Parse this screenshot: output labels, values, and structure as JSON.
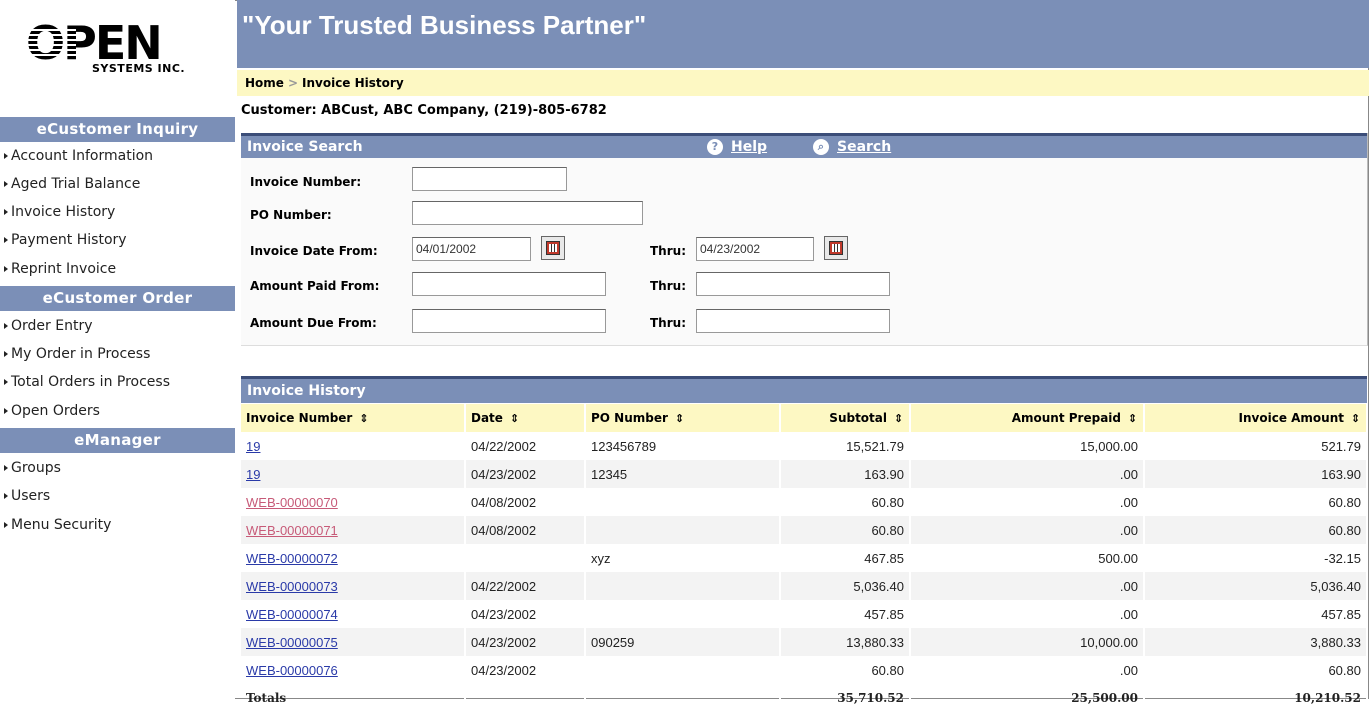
{
  "brand": {
    "logo_word": "OPEN",
    "logo_sub": "SYSTEMS INC."
  },
  "header": {
    "slogan": "\"Your Trusted Business Partner\""
  },
  "breadcrumb": {
    "home": "Home",
    "sep": ">",
    "current": "Invoice History"
  },
  "customer": "Customer: ABCust, ABC Company, (219)-805-6782",
  "sidebar": {
    "sections": [
      {
        "title": "eCustomer Inquiry",
        "items": [
          "Account Information",
          "Aged Trial Balance",
          "Invoice History",
          "Payment History",
          "Reprint Invoice"
        ]
      },
      {
        "title": "eCustomer Order",
        "items": [
          "Order Entry",
          "My Order in Process",
          "Total Orders in Process",
          "Open Orders"
        ]
      },
      {
        "title": "eManager",
        "items": [
          "Groups",
          "Users",
          "Menu Security"
        ]
      }
    ]
  },
  "search": {
    "title": "Invoice Search",
    "help_label": "Help",
    "search_label": "Search",
    "invoice_number_label": "Invoice Number:",
    "invoice_number_value": "",
    "po_number_label": "PO Number:",
    "po_number_value": "",
    "date_from_label": "Invoice Date From:",
    "date_from_value": "04/01/2002",
    "date_thru_label": "Thru:",
    "date_thru_value": "04/23/2002",
    "paid_from_label": "Amount Paid From:",
    "paid_from_value": "",
    "paid_thru_label": "Thru:",
    "paid_thru_value": "",
    "due_from_label": "Amount Due From:",
    "due_from_value": "",
    "due_thru_label": "Thru:",
    "due_thru_value": ""
  },
  "history": {
    "title": "Invoice History",
    "sort_glyph": "⇕",
    "columns": [
      "Invoice Number",
      "Date",
      "PO Number",
      "Subtotal",
      "Amount Prepaid",
      "Invoice Amount"
    ],
    "rows": [
      {
        "invoice": "19",
        "visited": false,
        "date": "04/22/2002",
        "po": "123456789",
        "subtotal": "15,521.79",
        "prepaid": "15,000.00",
        "amount": "521.79"
      },
      {
        "invoice": "19",
        "visited": false,
        "date": "04/23/2002",
        "po": "12345",
        "subtotal": "163.90",
        "prepaid": ".00",
        "amount": "163.90"
      },
      {
        "invoice": "WEB-00000070",
        "visited": true,
        "date": "04/08/2002",
        "po": "",
        "subtotal": "60.80",
        "prepaid": ".00",
        "amount": "60.80"
      },
      {
        "invoice": "WEB-00000071",
        "visited": true,
        "date": "04/08/2002",
        "po": "",
        "subtotal": "60.80",
        "prepaid": ".00",
        "amount": "60.80"
      },
      {
        "invoice": "WEB-00000072",
        "visited": false,
        "date": "",
        "po": "xyz",
        "subtotal": "467.85",
        "prepaid": "500.00",
        "amount": "-32.15"
      },
      {
        "invoice": "WEB-00000073",
        "visited": false,
        "date": "04/22/2002",
        "po": "",
        "subtotal": "5,036.40",
        "prepaid": ".00",
        "amount": "5,036.40"
      },
      {
        "invoice": "WEB-00000074",
        "visited": false,
        "date": "04/23/2002",
        "po": "",
        "subtotal": "457.85",
        "prepaid": ".00",
        "amount": "457.85"
      },
      {
        "invoice": "WEB-00000075",
        "visited": false,
        "date": "04/23/2002",
        "po": "090259",
        "subtotal": "13,880.33",
        "prepaid": "10,000.00",
        "amount": "3,880.33"
      },
      {
        "invoice": "WEB-00000076",
        "visited": false,
        "date": "04/23/2002",
        "po": "",
        "subtotal": "60.80",
        "prepaid": ".00",
        "amount": "60.80"
      }
    ],
    "totals": {
      "label": "Totals",
      "subtotal": "35,710.52",
      "prepaid": "25,500.00",
      "amount": "10,210.52"
    }
  },
  "colors": {
    "band": "#7b8fb7",
    "band_border": "#3b4d78",
    "highlight": "#fdf8c3",
    "link": "#2a3aa8",
    "visited_link": "#c75a78"
  }
}
